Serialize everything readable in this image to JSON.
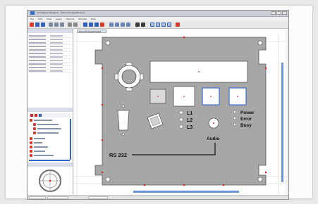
{
  "window": {
    "title": "Frontpanel Designer - [Panel Frontplatte.fpd]",
    "menu": [
      "File",
      "Edit",
      "View",
      "Insert",
      "Options",
      "Window",
      "Help"
    ]
  },
  "left_panel": {
    "properties_title": "",
    "tree_title": "",
    "preview_title": ""
  },
  "document_tab": "Panel Frontplatte.fpd",
  "panel": {
    "led_labels_left": [
      "L1",
      "L2",
      "L3"
    ],
    "led_labels_right": [
      "Power",
      "Error",
      "Busy"
    ],
    "rs232_label": "RS 232",
    "audio_label": "Audio"
  },
  "status": {
    "field1": "",
    "field2": "",
    "field3": ""
  },
  "colors": {
    "panel_gray": "#a7a7a7",
    "selection_blue": "#3f6fd0",
    "marker_red": "#d22a2a",
    "toolbar_icon_red": "#d63a2a",
    "toolbar_icon_blue": "#2f5fb8"
  }
}
